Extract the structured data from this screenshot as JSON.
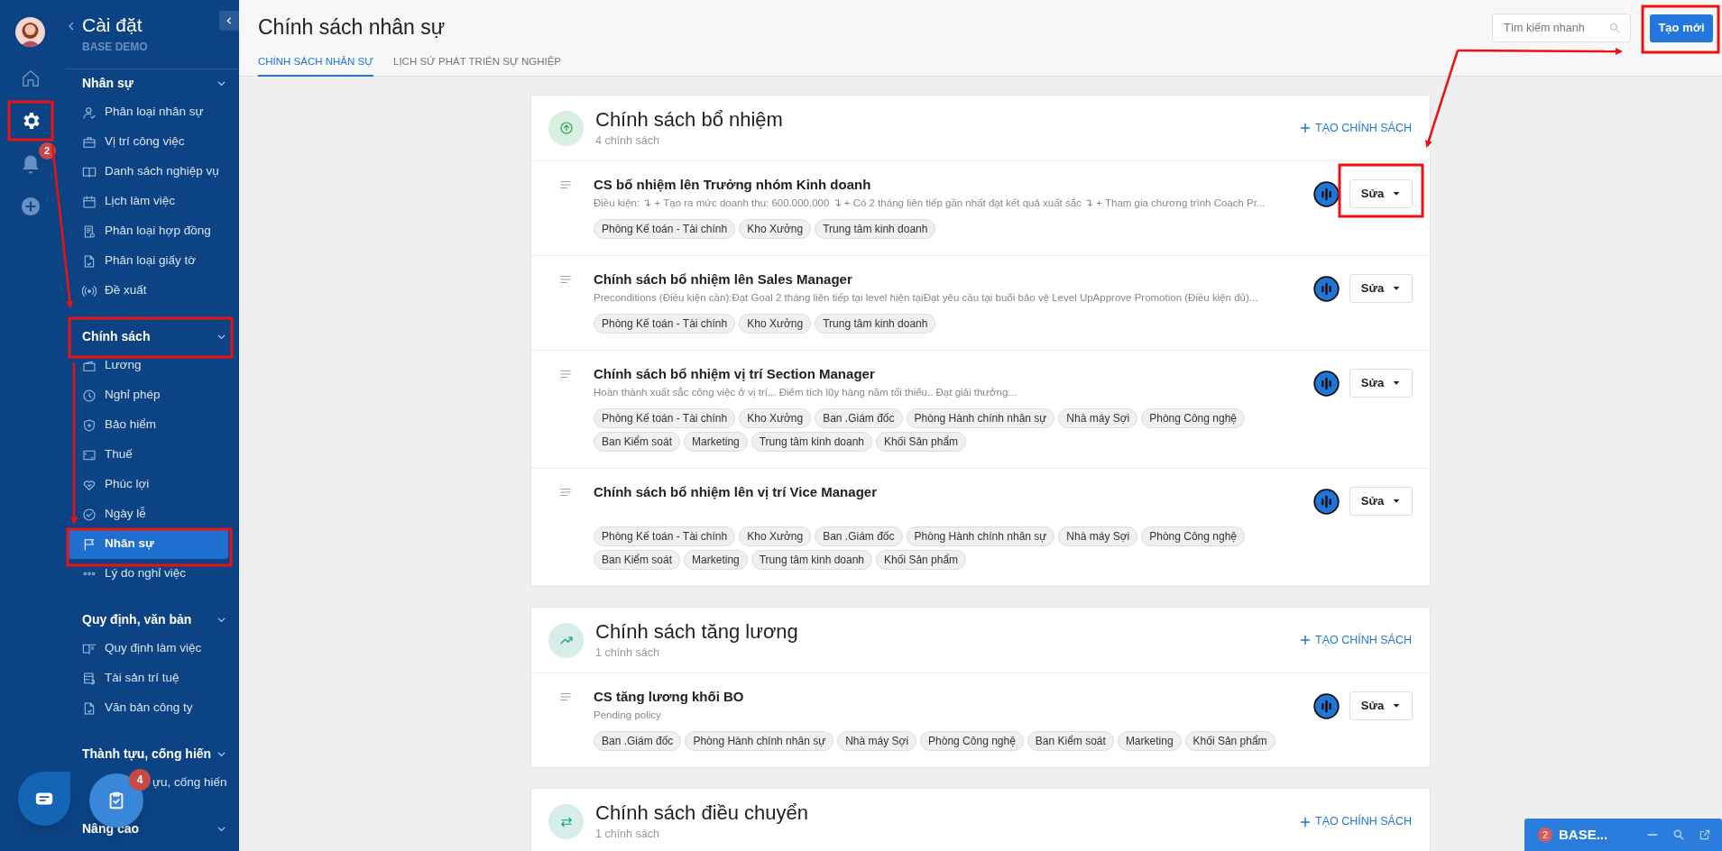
{
  "rail": {
    "notifications_badge": "2"
  },
  "settings_panel": {
    "title": "Cài đặt",
    "subtitle": "BASE DEMO",
    "sections": [
      {
        "title": "Nhân sự",
        "expanded": true,
        "items": [
          {
            "label": "Phân loại nhân sự",
            "selected": false
          },
          {
            "label": "Vị trí công việc",
            "selected": false
          },
          {
            "label": "Danh sách nghiệp vụ",
            "selected": false
          },
          {
            "label": "Lịch làm việc",
            "selected": false
          },
          {
            "label": "Phân loại hợp đồng",
            "selected": false
          },
          {
            "label": "Phân loại giấy tờ",
            "selected": false
          },
          {
            "label": "Đề xuất",
            "selected": false
          }
        ]
      },
      {
        "title": "Chính sách",
        "expanded": true,
        "items": [
          {
            "label": "Lương",
            "selected": false
          },
          {
            "label": "Nghỉ phép",
            "selected": false
          },
          {
            "label": "Bảo hiểm",
            "selected": false
          },
          {
            "label": "Thuế",
            "selected": false
          },
          {
            "label": "Phúc lợi",
            "selected": false
          },
          {
            "label": "Ngày lễ",
            "selected": false
          },
          {
            "label": "Nhân sự",
            "selected": true
          },
          {
            "label": "Lý do nghỉ việc",
            "selected": false
          }
        ]
      },
      {
        "title": "Quy định, văn bản",
        "expanded": true,
        "items": [
          {
            "label": "Quy định làm việc",
            "selected": false
          },
          {
            "label": "Tài sản trí tuệ",
            "selected": false
          },
          {
            "label": "Văn bản công ty",
            "selected": false
          }
        ]
      },
      {
        "title": "Thành tựu, cống hiến",
        "expanded": true,
        "items": [
          {
            "label": "ựu, cống hiến",
            "selected": false,
            "kind": "covered"
          }
        ]
      },
      {
        "title": "Nâng cao",
        "expanded": true
      }
    ]
  },
  "header": {
    "title": "Chính sách nhân sự",
    "tabs": [
      {
        "label": "CHÍNH SÁCH NHÂN SỰ",
        "selected": true
      },
      {
        "label": "LỊCH SỬ PHÁT TRIỂN SỰ NGHIỆP",
        "selected": false
      }
    ],
    "search": {
      "placeholder": "Tìm kiếm nhanh"
    },
    "create_button": "Tạo mới"
  },
  "groups": [
    {
      "title": "Chính sách bổ nhiệm",
      "count": "4 chính sách",
      "color": "#2ea44f",
      "action": "TẠO CHÍNH SÁCH",
      "policies": [
        {
          "title": "CS bổ nhiệm lên Trưởng nhóm Kinh doanh",
          "description": "Điều kiện: ↴ + Tạo ra mức doanh thu: 600.000.000 ↴ + Có 2 tháng liên tiếp gần nhất đạt kết quả xuất sắc ↴ + Tham gia chương trình Coach Pr...",
          "tags": [
            "Phòng Kế toán - Tài chính",
            "Kho Xưởng",
            "Trung tâm kinh doanh"
          ],
          "edit_button": "Sửa"
        },
        {
          "title": "Chính sách bổ nhiệm lên Sales Manager",
          "description": "Preconditions (Điều kiện cần):Đạt Goal 2 tháng liên tiếp tại level hiện tạiĐạt yêu cầu tại buổi bảo vệ Level UpApprove Promotion (Điều kiện đủ)...",
          "tags": [
            "Phòng Kế toán - Tài chính",
            "Kho Xưởng",
            "Trung tâm kinh doanh"
          ],
          "edit_button": "Sửa"
        },
        {
          "title": "Chính sách bổ nhiệm vị trí Section Manager",
          "description": "Hoàn thành xuất sắc công việc ở vị trí... Điểm tích lũy hàng năm tối thiểu.. Đạt giải thưởng...",
          "tags": [
            "Phòng Kế toán - Tài chính",
            "Kho Xưởng",
            "Ban .Giám đốc",
            "Phòng Hành chính nhân sự",
            "Nhà máy Sợi",
            "Phòng Công nghệ",
            "Ban Kiểm soát",
            "Marketing",
            "Trung tâm kinh doanh",
            "Khối Sản phẩm"
          ],
          "edit_button": "Sửa"
        },
        {
          "title": "Chính sách bổ nhiệm lên vị trí Vice Manager",
          "tags": [
            "Phòng Kế toán - Tài chính",
            "Kho Xưởng",
            "Ban .Giám đốc",
            "Phòng Hành chính nhân sự",
            "Nhà máy Sợi",
            "Phòng Công nghệ",
            "Ban Kiểm soát",
            "Marketing",
            "Trung tâm kinh doanh",
            "Khối Sản phẩm"
          ],
          "edit_button": "Sửa"
        }
      ]
    },
    {
      "title": "Chính sách tăng lương",
      "count": "1 chính sách",
      "color": "#1a9a8a",
      "action": "TẠO CHÍNH SÁCH",
      "policies": [
        {
          "title": "CS tăng lương khối BO",
          "description": "Pending policy",
          "tags": [
            "Ban .Giám đốc",
            "Phòng Hành chính nhân sự",
            "Nhà máy Sợi",
            "Phòng Công nghệ",
            "Ban Kiểm soát",
            "Marketing",
            "Khối Sản phẩm"
          ],
          "edit_button": "Sửa"
        }
      ]
    },
    {
      "title": "Chính sách điều chuyển",
      "count": "1 chính sách",
      "color": "#1a9a8a",
      "action": "TẠO CHÍNH SÁCH"
    }
  ],
  "floating": {
    "tasks_badge": "4"
  },
  "chat_bar": {
    "badge": "2",
    "title": "BASE..."
  }
}
